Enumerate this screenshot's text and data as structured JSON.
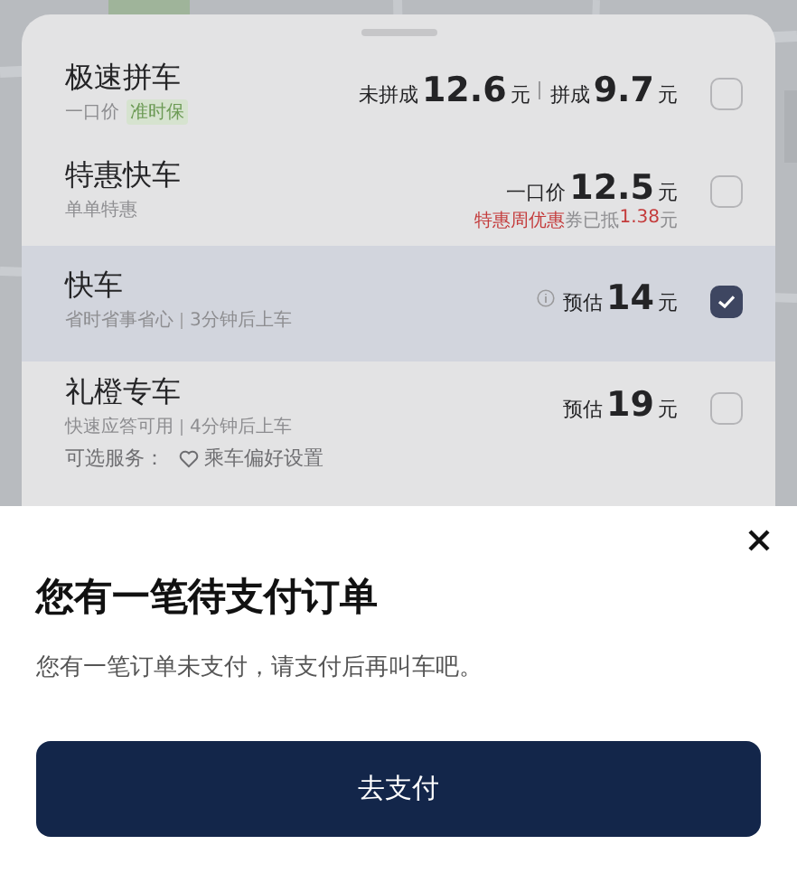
{
  "options": [
    {
      "name": "极速拼车",
      "checked": false,
      "highlighted": false,
      "subtitle": [
        {
          "kind": "text",
          "text": "一口价"
        },
        {
          "kind": "tag",
          "text": "准时保"
        }
      ],
      "price": [
        {
          "kind": "label",
          "text": "未拼成"
        },
        {
          "kind": "amount",
          "text": "12.6"
        },
        {
          "kind": "unit",
          "text": "元"
        },
        {
          "kind": "divider"
        },
        {
          "kind": "label",
          "text": "拼成"
        },
        {
          "kind": "amount",
          "text": "9.7"
        },
        {
          "kind": "unit",
          "text": "元"
        }
      ]
    },
    {
      "name": "特惠快车",
      "checked": false,
      "highlighted": false,
      "subtitle": [
        {
          "kind": "text",
          "text": "单单特惠"
        }
      ],
      "price": [
        {
          "kind": "label",
          "text": "一口价"
        },
        {
          "kind": "amount",
          "text": "12.5"
        },
        {
          "kind": "unit",
          "text": "元"
        }
      ],
      "discount": [
        {
          "kind": "highlight",
          "text": "特惠周优惠"
        },
        {
          "kind": "text",
          "text": "券已抵"
        },
        {
          "kind": "highlight",
          "text": "1.38"
        },
        {
          "kind": "text",
          "text": "元"
        }
      ]
    },
    {
      "name": "快车",
      "checked": true,
      "highlighted": true,
      "subtitle": [
        {
          "kind": "text",
          "text": "省时省事省心"
        },
        {
          "kind": "divider"
        },
        {
          "kind": "text",
          "text": "3分钟后上车"
        }
      ],
      "price": [
        {
          "kind": "info"
        },
        {
          "kind": "label",
          "text": "预估"
        },
        {
          "kind": "amount",
          "text": "14"
        },
        {
          "kind": "unit",
          "text": "元"
        }
      ]
    },
    {
      "name": "礼橙专车",
      "checked": false,
      "highlighted": false,
      "subtitle": [
        {
          "kind": "text",
          "text": "快速应答可用"
        },
        {
          "kind": "divider"
        },
        {
          "kind": "text",
          "text": "4分钟后上车"
        }
      ],
      "price": [
        {
          "kind": "label",
          "text": "预估"
        },
        {
          "kind": "amount",
          "text": "19"
        },
        {
          "kind": "unit",
          "text": "元"
        }
      ],
      "services": {
        "label": "可选服务：",
        "link": "乘车偏好设置"
      }
    }
  ],
  "dialog": {
    "title": "您有一笔待支付订单",
    "message": "您有一笔订单未支付，请支付后再叫车吧。",
    "button": "去支付"
  }
}
